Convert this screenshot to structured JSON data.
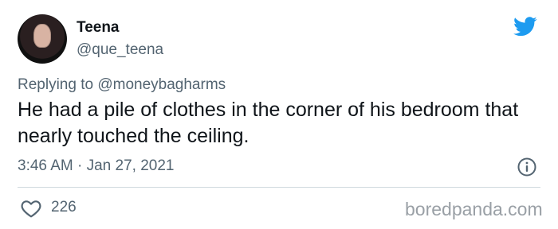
{
  "author": {
    "name": "Teena",
    "handle": "@que_teena"
  },
  "reply": {
    "prefix": "Replying to",
    "user": "@moneybagharms"
  },
  "tweet": {
    "text": "He had a pile of clothes in the corner of his bedroom that nearly touched the ceiling."
  },
  "meta": {
    "timestamp": "3:46 AM · Jan 27, 2021"
  },
  "actions": {
    "likes": "226"
  },
  "watermark": "boredpanda.com",
  "colors": {
    "twitter_blue": "#1d9bf0",
    "muted": "#536471"
  }
}
